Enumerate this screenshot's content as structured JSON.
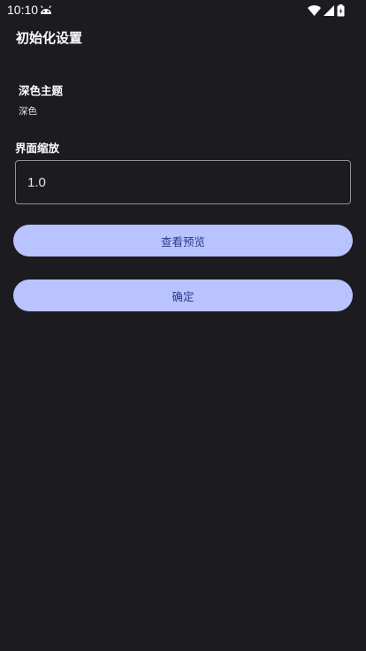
{
  "status_bar": {
    "time": "10:10",
    "icons": [
      "android-notification-icon",
      "wifi-icon",
      "cell-signal-icon",
      "battery-icon"
    ]
  },
  "header": {
    "title": "初始化设置"
  },
  "theme_setting": {
    "label": "深色主题",
    "value": "深色"
  },
  "scale_setting": {
    "label": "界面缩放",
    "value": "1.0"
  },
  "buttons": {
    "preview_label": "查看预览",
    "confirm_label": "确定"
  },
  "colors": {
    "background": "#1c1b20",
    "button_bg": "#b8c3ff",
    "button_text": "#2b3b8c",
    "outline": "#938f99"
  }
}
